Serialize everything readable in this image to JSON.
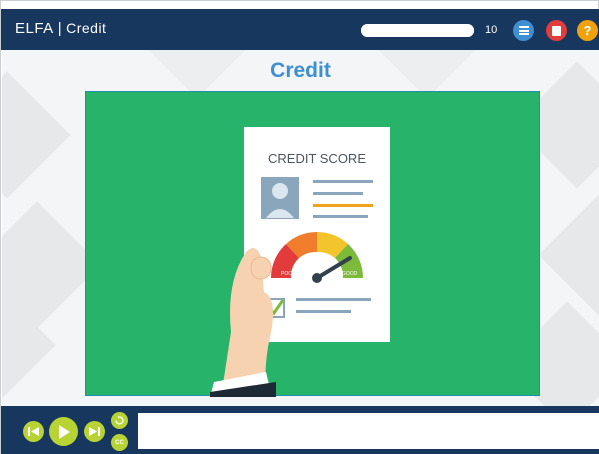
{
  "header": {
    "brand": "ELFA",
    "separator": "|",
    "course_title": "Credit",
    "progress_fraction": 1.0,
    "page_number": "10",
    "icons": {
      "menu": "menu-icon",
      "exit": "exit-icon",
      "help": "help-icon"
    },
    "help_glyph": "?"
  },
  "slide": {
    "title": "Credit",
    "illustration": {
      "document_heading": "CREDIT SCORE",
      "gauge_low_label": "POOR",
      "gauge_high_label": "GOOD"
    }
  },
  "controls": {
    "icons": [
      "previous-icon",
      "play-icon",
      "next-icon",
      "replay-icon",
      "closed-captions-icon"
    ],
    "cc_label": "CC",
    "caption_text": ""
  },
  "colors": {
    "header_bg": "#17375e",
    "accent_blue": "#3d8fd1",
    "media_green": "#27b36a",
    "control_lime": "#b7d334",
    "menu_btn": "#3f8fd4",
    "exit_btn": "#e23d3d",
    "help_btn": "#f0a20e"
  }
}
